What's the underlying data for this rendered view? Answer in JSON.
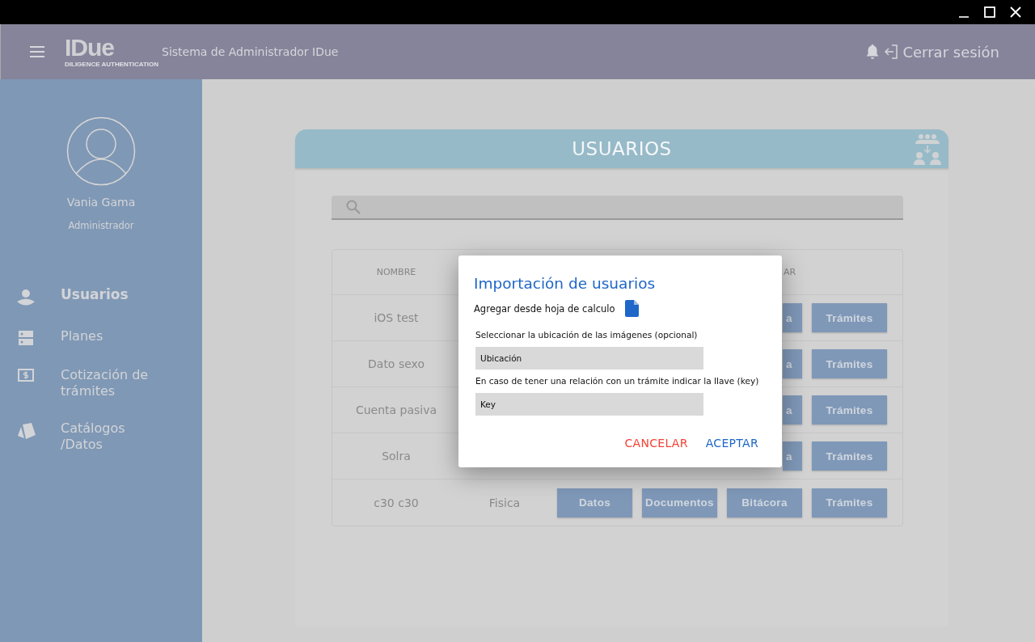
{
  "topbar": {
    "logo": "IDue",
    "logo_tagline": "DILIGENCE AUTHENTICATION",
    "app_title": "Sistema de Administrador IDue",
    "logout": "Cerrar sesión"
  },
  "sidebar": {
    "user_name": "Vania Gama",
    "user_role": "Administrador",
    "items": [
      {
        "label": "Usuarios",
        "selected": true
      },
      {
        "label": "Planes",
        "selected": false
      },
      {
        "label": "Cotización de trámites",
        "selected": false
      },
      {
        "label": "Catálogos /Datos",
        "selected": false
      }
    ]
  },
  "card": {
    "title": "USUARIOS"
  },
  "table": {
    "columns": [
      "NOMBRE",
      "AR"
    ],
    "rows": [
      {
        "name": "iOS test",
        "covered": true,
        "actions": [
          "a",
          "Trámites"
        ]
      },
      {
        "name": "Dato sexo",
        "covered": true,
        "actions": [
          "a",
          "Trámites"
        ]
      },
      {
        "name": "Cuenta pasiva",
        "covered": true,
        "actions": [
          "a",
          "Trámites"
        ]
      },
      {
        "name": "Solra",
        "covered": true,
        "actions": [
          "a",
          "Trámites"
        ]
      },
      {
        "name": "c30 c30",
        "covered": false,
        "type": "Fisica",
        "actions": [
          "Datos",
          "Documentos",
          "Bitácora",
          "Trámites"
        ]
      }
    ]
  },
  "dialog": {
    "title": "Importación de usuarios",
    "spreadsheet_label": "Agregar desde hoja de calculo",
    "fields": [
      {
        "label": "Seleccionar la ubicación de las imágenes (opcional)",
        "placeholder": "Ubicación"
      },
      {
        "label": "En caso de tener una relación con un trámite indicar la llave (key)",
        "placeholder": "Key"
      }
    ],
    "buttons": [
      {
        "label": "CANCELAR",
        "kind": "cancel"
      },
      {
        "label": "ACEPTAR",
        "kind": "accept"
      }
    ]
  }
}
